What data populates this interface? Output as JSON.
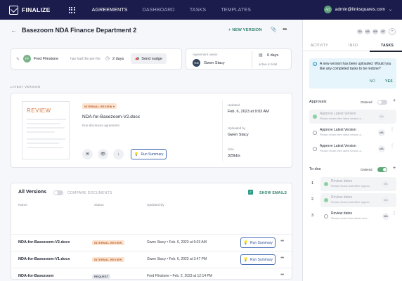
{
  "topbar": {
    "logo_text": "FINALIZE",
    "nav": [
      "AGREEMENTS",
      "DASHBOARD",
      "TASKS",
      "TEMPLATES"
    ],
    "active_nav": "AGREEMENTS",
    "user_initials": "AD",
    "user_email": "admin@linksquares.com"
  },
  "header": {
    "title": "Basezoom NDA Finance Department 2",
    "new_version_label": "+ NEW VERSION"
  },
  "pen": {
    "avatar_initials": "FF",
    "name": "Fred Flinstone",
    "text": "has had the pen for",
    "days": "2 days",
    "nudge_label": "Send nudge"
  },
  "owner": {
    "label": "Agreement owner",
    "avatar_initials": "GS",
    "name": "Gwen Stacy",
    "days": "6 days",
    "sub": "active in total"
  },
  "latest": {
    "section_label": "LATEST VERSION",
    "thumb_title": "REVIEW",
    "badge": "INTERNAL REVIEW",
    "name": "NDA-for-Basezoom-V2.docx",
    "type": "Non-disclosure agreement",
    "run_summary_label": "Run Summary",
    "updated_label": "Updated",
    "updated_value": "Feb. 6, 2023 at 9:03 AM",
    "uploaded_by_label": "Uploaded by",
    "uploaded_by_value": "Gwen Stacy",
    "size_label": "Size",
    "size_value": "325kbs"
  },
  "versions": {
    "title": "All Versions",
    "compare_label": "COMPARE DOCUMENTS",
    "show_emails_label": "SHOW EMAILS",
    "columns": [
      "Name",
      "Status",
      "Updated by"
    ],
    "rows": [
      {
        "name": "NDA-for-Basezoom-V2.docx",
        "status": "INTERNAL REVIEW",
        "updated": "Gwen Stacy  •  Feb. 6, 2023 at 9:03 AM",
        "run_label": "Run Summary"
      },
      {
        "name": "NDA-for-Basezoom-V1.docx",
        "status": "INTERNAL REVIEW",
        "updated": "Gwen Stacy  •  Feb. 6, 2023 at 3:47 PM",
        "run_label": "Run Summary"
      },
      {
        "name": "NDA-for-Basezoom",
        "status": "REQUEST",
        "updated": "Fred Flinstone  •  Feb. 2, 2023 at 12:14 PM"
      }
    ]
  },
  "side": {
    "collaborators": [
      "GA",
      "MA",
      "WA",
      "UF"
    ],
    "tabs": [
      "ACTIVITY",
      "INFO",
      "TASKS"
    ],
    "active_tab": "TASKS",
    "notice_text": "A new version has been uploaded. Would you like any completed tasks to be redone?",
    "notice_no": "NO",
    "notice_yes": "YES",
    "approvals": {
      "title": "Approvals",
      "ordered_label": "Ordered",
      "items": [
        {
          "title": "Approve Latest Version",
          "sub": "Please review then latest version a...",
          "assignee": "MA",
          "done": true
        },
        {
          "title": "Approve Latest Version",
          "sub": "Please review then latest version a...",
          "assignee": "MA",
          "done": false
        },
        {
          "title": "Approve Latest Version",
          "sub": "Please review then latest version a...",
          "assignee": "MA",
          "done": false
        }
      ]
    },
    "todos": {
      "title": "To-dos",
      "ordered_label": "Ordered",
      "items": [
        {
          "num": "1",
          "title": "Review dates",
          "sub": "Please review and either approv...",
          "assignee": "MA",
          "done": true
        },
        {
          "num": "2",
          "title": "Review dates",
          "sub": "Please review and either approv...",
          "assignee": "MA",
          "done": true
        },
        {
          "num": "3",
          "title": "Review dates",
          "sub": "Please review then latest versi...",
          "assignee": "MA",
          "done": false
        }
      ]
    }
  }
}
